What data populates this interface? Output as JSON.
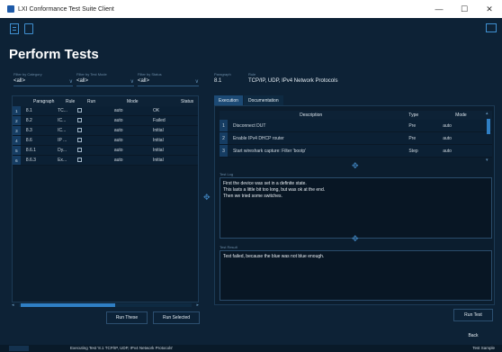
{
  "window": {
    "title": "LXI Conformance Test Suite Client",
    "minimize": "—",
    "maximize": "☐",
    "close": "✕"
  },
  "page": {
    "title": "Perform Tests"
  },
  "filters": [
    {
      "label": "Filter by Category",
      "value": "<all>"
    },
    {
      "label": "Filter by Test Mode",
      "value": "<all>"
    },
    {
      "label": "Filter by Status",
      "value": "<all>"
    }
  ],
  "selection": {
    "paragraph_label": "Paragraph",
    "paragraph": "8.1",
    "rule_label": "Rule",
    "rule": "TCP/IP, UDP, IPv4 Network Protocols"
  },
  "tests_table": {
    "columns": [
      "Paragraph",
      "Rule",
      "Run",
      "Mode",
      "Status"
    ],
    "rows": [
      {
        "num": "1",
        "paragraph": "8.1",
        "rule": "TC...",
        "mode": "auto",
        "status": "OK"
      },
      {
        "num": "2",
        "paragraph": "8.2",
        "rule": "IC...",
        "mode": "auto",
        "status": "Failed"
      },
      {
        "num": "3",
        "paragraph": "8.3",
        "rule": "IC...",
        "mode": "auto",
        "status": "Initial"
      },
      {
        "num": "4",
        "paragraph": "8.6",
        "rule": "IP ...",
        "mode": "auto",
        "status": "Initial"
      },
      {
        "num": "5",
        "paragraph": "8.6.1",
        "rule": "Dy...",
        "mode": "auto",
        "status": "Initial"
      },
      {
        "num": "6",
        "paragraph": "8.6.3",
        "rule": "Ex...",
        "mode": "auto",
        "status": "Initial"
      }
    ]
  },
  "buttons": {
    "run_these": "Run These",
    "run_selected": "Run Selected",
    "run_test": "Run Test",
    "back": "Back"
  },
  "tabs": [
    {
      "label": "Execution"
    },
    {
      "label": "Documentation"
    }
  ],
  "steps_table": {
    "columns": [
      "Description",
      "Type",
      "Mode"
    ],
    "rows": [
      {
        "num": "1",
        "description": "Disconnect DUT",
        "type": "Pre",
        "mode": "auto"
      },
      {
        "num": "2",
        "description": "Enable IPv4 DHCP router",
        "type": "Pre",
        "mode": "auto"
      },
      {
        "num": "3",
        "description": "Start wireshark capture: Filter 'bootp'",
        "type": "Step",
        "mode": "auto"
      }
    ]
  },
  "test_log": {
    "label": "Test Log",
    "text": "First the device was set in a definite state.\nThis lasts a little bit too long, but was ok at the end.\nThen we tried some switches."
  },
  "test_result": {
    "label": "Test Result",
    "text": "Test failed, because the blue was not blue enough."
  },
  "status_bar": {
    "status": "Executing Test '8.1 TCP/IP, UDP, IPv4 Network Protocols'",
    "sample": "Test Sample"
  }
}
